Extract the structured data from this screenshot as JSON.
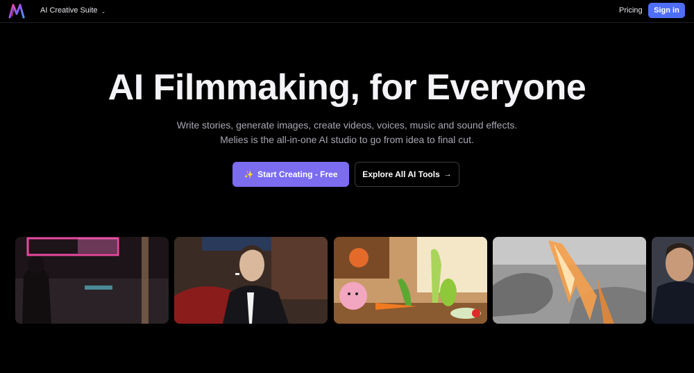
{
  "nav": {
    "suite_label": "AI Creative Suite",
    "pricing_label": "Pricing",
    "signin_label": "Sign in"
  },
  "hero": {
    "title": "AI Filmmaking, for Everyone",
    "subtitle_line1": "Write stories, generate images, create videos, voices, music and sound effects.",
    "subtitle_line2": "Melies is the all-in-one AI studio to go from idea to final cut.",
    "primary_cta": "Start Creating - Free",
    "secondary_cta": "Explore All AI Tools"
  },
  "colors": {
    "accent_blue": "#4f6ef7",
    "accent_purple": "#7b6cf0",
    "background": "#000000"
  },
  "gallery": {
    "items": [
      {
        "subject": "neon-street-scene"
      },
      {
        "subject": "man-in-suit-smoking"
      },
      {
        "subject": "animated-vegetables"
      },
      {
        "subject": "fire-explosion-sketch"
      },
      {
        "subject": "man-portrait"
      }
    ]
  }
}
